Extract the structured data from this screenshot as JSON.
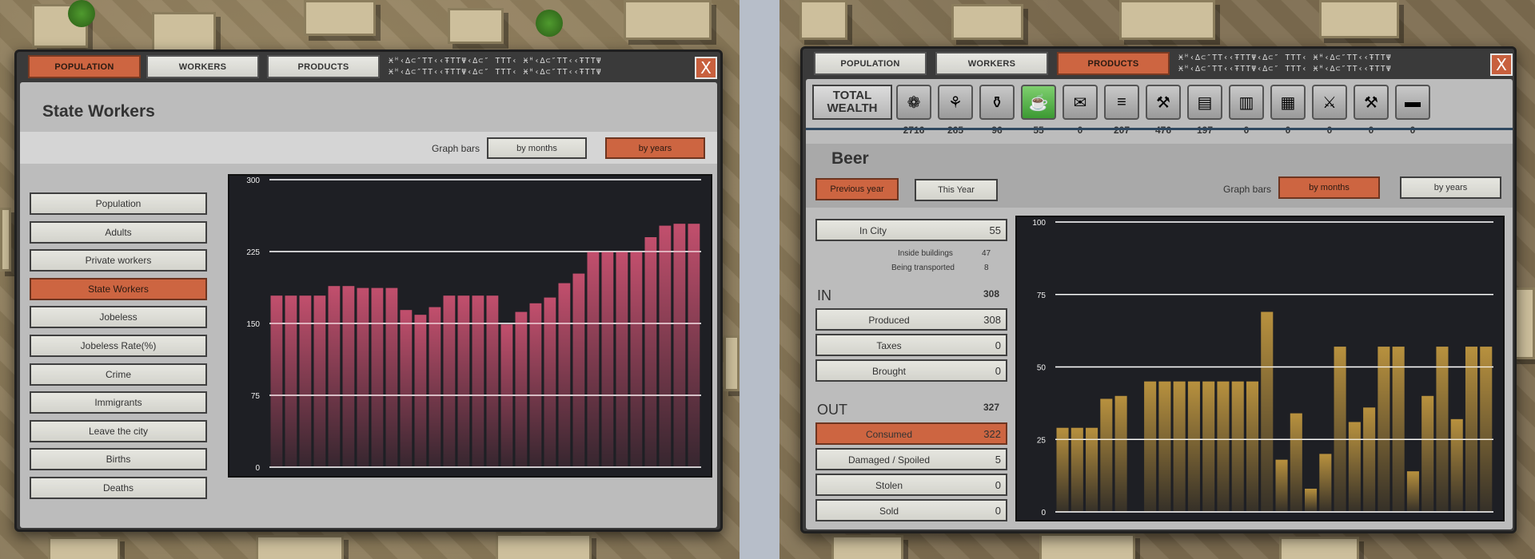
{
  "left": {
    "tabs": [
      {
        "label": "POPULATION",
        "active": true
      },
      {
        "label": "WORKERS",
        "active": false
      },
      {
        "label": "PRODUCTS",
        "active": false
      }
    ],
    "glyphs": "Ӿᴴ‹∆⊂″ΤΤ‹‹ŦΤΤΨ‹∆⊂″ ΤΤΤ‹ Ӿᴴ‹∆⊂″ΤΤ‹‹ŦΤΤΨ",
    "close_label": "X",
    "title": "State Workers",
    "graph_bars_label": "Graph bars",
    "by_months": "by months",
    "by_years": "by years",
    "active_graph_mode": "by years",
    "sidebar": [
      {
        "label": "Population",
        "active": false
      },
      {
        "label": "Adults",
        "active": false
      },
      {
        "label": "Private workers",
        "active": false
      },
      {
        "label": "State Workers",
        "active": true
      },
      {
        "label": "Jobeless",
        "active": false
      },
      {
        "label": "Jobeless Rate(%)",
        "active": false
      },
      {
        "label": "Crime",
        "active": false
      },
      {
        "label": "Immigrants",
        "active": false
      },
      {
        "label": "Leave the city",
        "active": false
      },
      {
        "label": "Births",
        "active": false
      },
      {
        "label": "Deaths",
        "active": false
      }
    ],
    "bar_color": "#c24f6d"
  },
  "right": {
    "tabs": [
      {
        "label": "POPULATION",
        "active": false
      },
      {
        "label": "WORKERS",
        "active": false
      },
      {
        "label": "PRODUCTS",
        "active": true
      }
    ],
    "close_label": "X",
    "total_wealth_label": "TOTAL WEALTH",
    "products": [
      {
        "icon": "wheat-icon",
        "glyph": "❁",
        "value": "2716"
      },
      {
        "icon": "flax-icon",
        "glyph": "⚘",
        "value": "265"
      },
      {
        "icon": "pottery-icon",
        "glyph": "⚱",
        "value": "96"
      },
      {
        "icon": "beer-icon",
        "glyph": "☕",
        "value": "55",
        "active": true
      },
      {
        "icon": "papyrus-icon",
        "glyph": "✉",
        "value": "0"
      },
      {
        "icon": "books-icon",
        "glyph": "≡",
        "value": "207"
      },
      {
        "icon": "wood-icon",
        "glyph": "⚒",
        "value": "476"
      },
      {
        "icon": "gold-icon",
        "glyph": "▤",
        "value": "197"
      },
      {
        "icon": "copper-icon",
        "glyph": "▥",
        "value": "0"
      },
      {
        "icon": "stone-icon",
        "glyph": "▦",
        "value": "0"
      },
      {
        "icon": "weapon-icon",
        "glyph": "⚔",
        "value": "0"
      },
      {
        "icon": "tool-icon",
        "glyph": "⚒",
        "value": "0"
      },
      {
        "icon": "timber-icon",
        "glyph": "▬",
        "value": "0"
      }
    ],
    "title": "Beer",
    "previous_year": "Previous year",
    "this_year": "This Year",
    "graph_bars_label": "Graph bars",
    "by_months": "by months",
    "by_years": "by years",
    "in_city": {
      "label": "In City",
      "value": "55"
    },
    "inside_buildings": {
      "label": "Inside buildings",
      "value": "47"
    },
    "being_transported": {
      "label": "Being transported",
      "value": "8"
    },
    "in_section": {
      "label": "IN",
      "value": "308"
    },
    "in_rows": [
      {
        "label": "Produced",
        "value": "308"
      },
      {
        "label": "Taxes",
        "value": "0"
      },
      {
        "label": "Brought",
        "value": "0"
      }
    ],
    "out_section": {
      "label": "OUT",
      "value": "327"
    },
    "out_rows": [
      {
        "label": "Consumed",
        "value": "322",
        "active": true
      },
      {
        "label": "Damaged / Spoiled",
        "value": "5"
      },
      {
        "label": "Stolen",
        "value": "0"
      },
      {
        "label": "Sold",
        "value": "0"
      }
    ],
    "bar_color": "#b8913e"
  },
  "chart_data": [
    {
      "type": "bar",
      "title": "State Workers",
      "ylim": [
        0,
        300
      ],
      "yticks": [
        "0",
        "75",
        "150",
        "225",
        "300"
      ],
      "values": [
        179,
        179,
        179,
        179,
        189,
        189,
        187,
        187,
        187,
        164,
        159,
        167,
        179,
        179,
        179,
        179,
        149,
        162,
        171,
        177,
        192,
        202,
        225,
        225,
        225,
        225,
        240,
        252,
        254,
        254
      ]
    },
    {
      "type": "bar",
      "title": "Beer",
      "ylim": [
        0,
        100
      ],
      "yticks": [
        "0",
        "25",
        "50",
        "75",
        "100"
      ],
      "values": [
        29,
        29,
        29,
        39,
        40,
        0,
        45,
        45,
        45,
        45,
        45,
        45,
        45,
        45,
        69,
        18,
        34,
        8,
        20,
        57,
        31,
        36,
        57,
        57,
        14,
        40,
        57,
        32,
        57,
        57
      ]
    }
  ]
}
